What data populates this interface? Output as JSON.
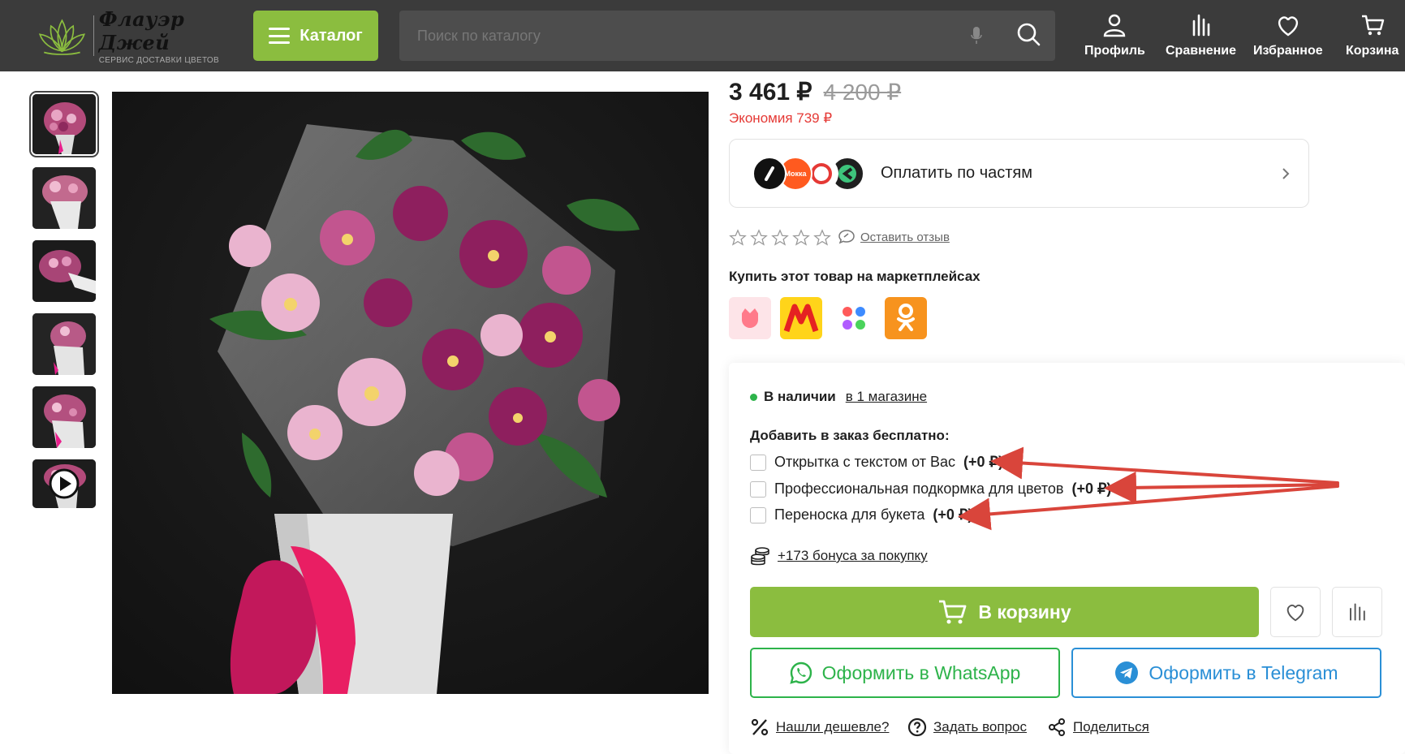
{
  "header": {
    "logo_name": "Флауэр Джей",
    "logo_sub": "СЕРВИС ДОСТАВКИ ЦВЕТОВ",
    "catalog_label": "Каталог",
    "search_placeholder": "Поиск по каталогу",
    "nav": [
      {
        "label": "Профиль",
        "icon": "user-icon"
      },
      {
        "label": "Сравнение",
        "icon": "compare-icon"
      },
      {
        "label": "Избранное",
        "icon": "heart-icon"
      },
      {
        "label": "Корзина",
        "icon": "cart-icon"
      }
    ]
  },
  "product": {
    "price": "3 461 ₽",
    "old_price": "4 200 ₽",
    "economy": "Экономия 739 ₽",
    "split_label": "Оплатить по частям",
    "review_link": "Оставить отзыв",
    "marketplaces_title": "Купить этот товар на маркетплейсах",
    "marketplaces": [
      "flowwow",
      "yandex-market",
      "vk-marketplace",
      "odnoklassniki"
    ]
  },
  "buy": {
    "availability": "В наличии",
    "availability_link": "в 1 магазине",
    "addons_title": "Добавить в заказ бесплатно:",
    "addons": [
      {
        "label": "Открытка с текстом от Вас",
        "price": "(+0 ₽)"
      },
      {
        "label": "Профессиональная подкормка для цветов",
        "price": "(+0 ₽)"
      },
      {
        "label": "Переноска для букета",
        "price": "(+0 ₽)"
      }
    ],
    "bonus": "+173 бонуса за покупку",
    "cart_label": "В корзину",
    "whatsapp_label": "Оформить в WhatsApp",
    "telegram_label": "Оформить в Telegram",
    "links": [
      "Нашли дешевле?",
      "Задать вопрос",
      "Поделиться"
    ]
  },
  "colors": {
    "accent_green": "#8bbd3f",
    "header_bg": "#3b3b3b",
    "economy_red": "#e53935",
    "whatsapp": "#2db34a",
    "telegram": "#2a8fd6",
    "annotation_arrow": "#d9453b"
  }
}
